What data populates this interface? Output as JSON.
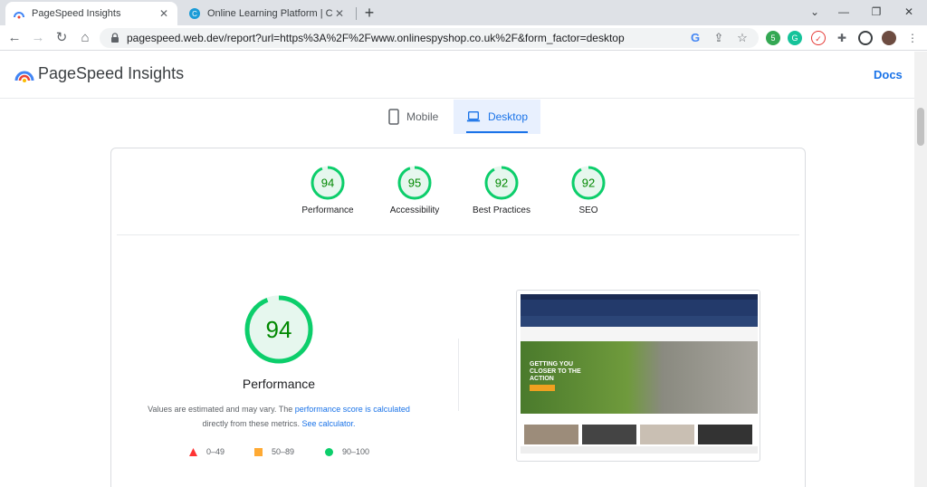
{
  "browser": {
    "tabs": [
      {
        "title": "PageSpeed Insights",
        "active": true
      },
      {
        "title": "Online Learning Platform | Corpo",
        "active": false
      }
    ],
    "url": "pagespeed.web.dev/report?url=https%3A%2F%2Fwww.onlinespyshop.co.uk%2F&form_factor=desktop"
  },
  "app": {
    "title": "PageSpeed Insights",
    "docs_label": "Docs"
  },
  "device_tabs": {
    "mobile": "Mobile",
    "desktop": "Desktop",
    "selected": "desktop"
  },
  "scores": [
    {
      "label": "Performance",
      "value": "94"
    },
    {
      "label": "Accessibility",
      "value": "95"
    },
    {
      "label": "Best Practices",
      "value": "92"
    },
    {
      "label": "SEO",
      "value": "92"
    }
  ],
  "performance": {
    "score": "94",
    "title": "Performance",
    "note_prefix": "Values are estimated and may vary. The ",
    "note_link1": "performance score is calculated",
    "note_mid": "directly from these metrics. ",
    "note_link2": "See calculator."
  },
  "legend": [
    {
      "range": "0–49",
      "color": "#ff3333"
    },
    {
      "range": "50–89",
      "color": "#ffaa33"
    },
    {
      "range": "90–100",
      "color": "#0cce6b"
    }
  ],
  "screenshot": {
    "hero_text": "GETTING YOU CLOSER TO THE ACTION"
  },
  "colors": {
    "pass": "#0cce6b",
    "pass_fill": "#e6f7ee",
    "link": "#1a73e8"
  }
}
